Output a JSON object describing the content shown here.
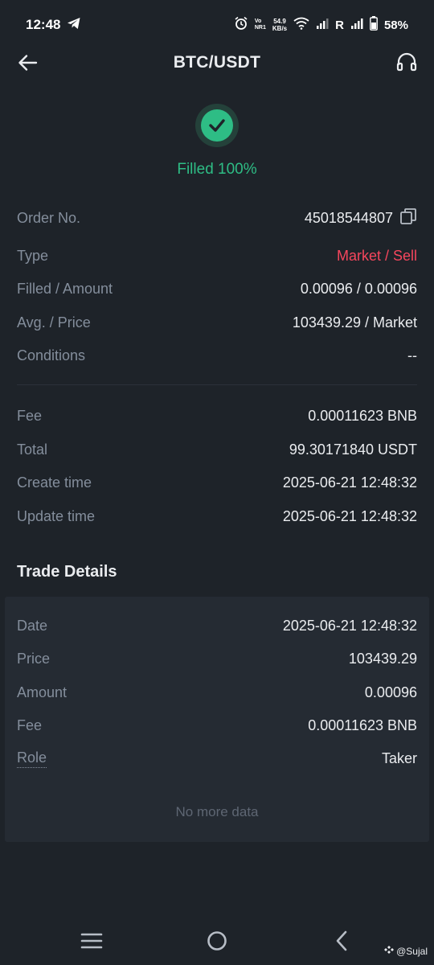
{
  "status_bar": {
    "time": "12:48",
    "net_speed_value": "54.9",
    "net_speed_unit": "KB/s",
    "volte_top": "Vo",
    "volte_bottom": "NR1",
    "roaming": "R",
    "battery": "58%"
  },
  "header": {
    "title": "BTC/USDT",
    "back_icon": "back-arrow-icon",
    "support_icon": "headset-icon"
  },
  "order_status": {
    "icon": "check-circle-icon",
    "text": "Filled 100%",
    "color": "#2ebd85"
  },
  "order_details": [
    {
      "label": "Order No.",
      "value": "45018544807"
    },
    {
      "label": "Type",
      "value": "Market / Sell"
    },
    {
      "label": "Filled / Amount",
      "value": "0.00096 / 0.00096"
    },
    {
      "label": "Avg. / Price",
      "value": "103439.29 / Market"
    },
    {
      "label": "Conditions",
      "value": "--"
    }
  ],
  "fee_details": [
    {
      "label": "Fee",
      "value": "0.00011623 BNB"
    },
    {
      "label": "Total",
      "value": "99.30171840 USDT"
    },
    {
      "label": "Create time",
      "value": "2025-06-21 12:48:32"
    },
    {
      "label": "Update time",
      "value": "2025-06-21 12:48:32"
    }
  ],
  "trade_details": {
    "title": "Trade Details",
    "rows": [
      {
        "label": "Date",
        "value": "2025-06-21 12:48:32"
      },
      {
        "label": "Price",
        "value": "103439.29"
      },
      {
        "label": "Amount",
        "value": "0.00096"
      },
      {
        "label": "Fee",
        "value": "0.00011623 BNB"
      },
      {
        "label": "Role",
        "value": "Taker"
      }
    ],
    "footer": "No more data"
  },
  "colors": {
    "background": "#1e2329",
    "card": "#252b33",
    "label": "#848e9c",
    "sell": "#f6465d",
    "success": "#2ebd85"
  },
  "nav_bar": {
    "menu_icon": "recent-apps-icon",
    "home_icon": "home-circle-icon",
    "back_icon": "nav-back-icon"
  },
  "watermark": "@Sujal"
}
